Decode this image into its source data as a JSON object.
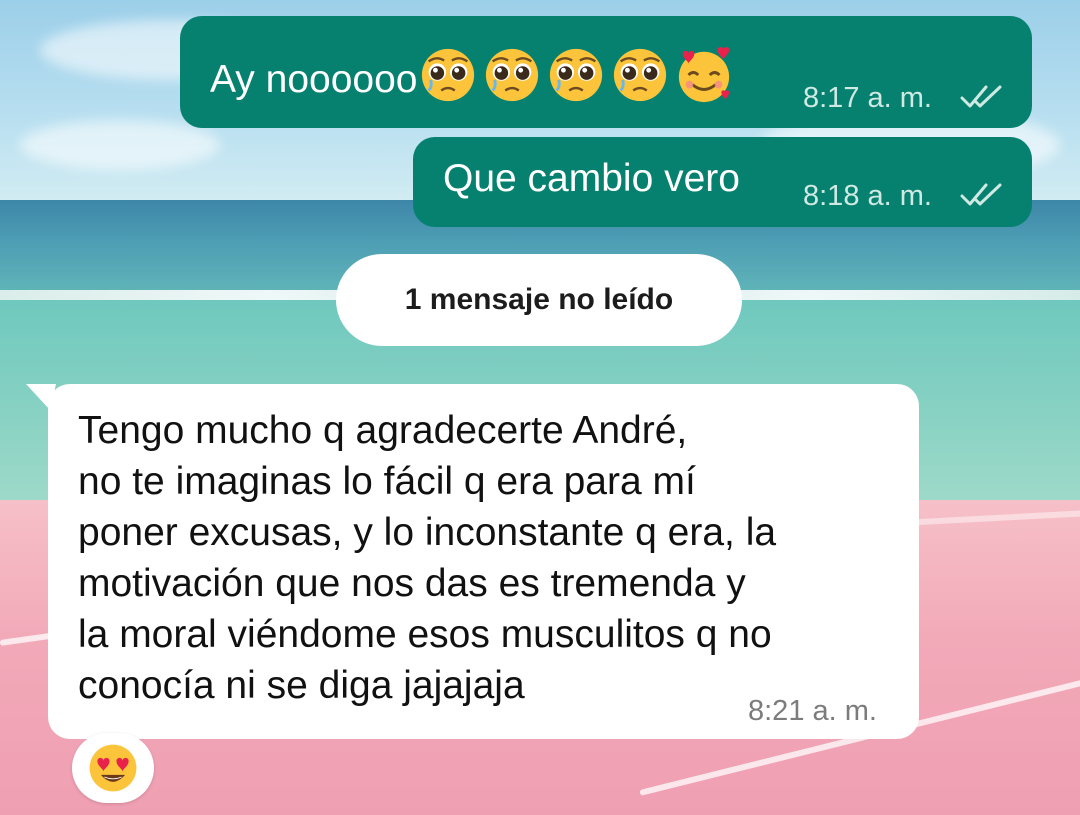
{
  "messages": [
    {
      "direction": "outgoing",
      "text": "Ay noooooo",
      "emojis": [
        "pleading-face-icon",
        "pleading-face-icon",
        "pleading-face-icon",
        "pleading-face-icon",
        "smiling-face-with-hearts-icon"
      ],
      "time": "8:17 a. m.",
      "status": "read"
    },
    {
      "direction": "outgoing",
      "text": "Que cambio vero",
      "time": "8:18 a. m.",
      "status": "read"
    },
    {
      "direction": "incoming",
      "lines": [
        "Tengo mucho q agradecerte André,",
        "no te imaginas lo fácil q era para mí",
        "poner excusas, y lo inconstante q era, la",
        "motivación que nos das es tremenda y",
        "la moral viéndome esos musculitos q no",
        "conocía ni se diga jajajaja"
      ],
      "time": "8:21 a. m.",
      "reaction": "heart-eyes-face-icon"
    }
  ],
  "unread_banner": "1 mensaje no leído",
  "colors": {
    "outgoing_bubble": "#06806f",
    "incoming_bubble": "#ffffff",
    "read_ticks": "#cfe9e3"
  }
}
